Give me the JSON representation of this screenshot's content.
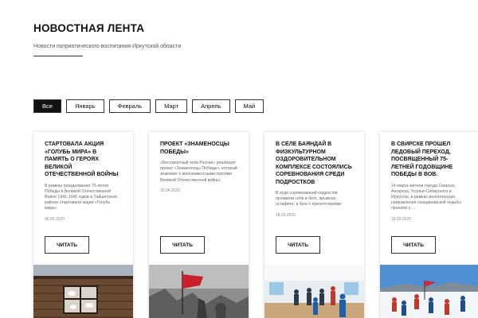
{
  "header": {
    "title": "НОВОСТНАЯ ЛЕНТА",
    "subtitle": "Новости патриотического воспитания Иркутской области"
  },
  "filters": [
    "Все",
    "Январь",
    "Февраль",
    "Март",
    "Апрель",
    "Май"
  ],
  "active_filter": "Все",
  "cards": [
    {
      "title": "СТАРТОВАЛА АКЦИЯ «ГОЛУБЬ МИРА» В ПАМЯТЬ О ГЕРОЯХ ВЕЛИКОЙ ОТЕЧЕСТВЕННОЙ ВОЙНЫ",
      "text": "В рамках празднования 75-летия Победы в Великой Отечественной Войне 1941-1945 годов в Тайшетском районе стартовала акция «Голубь мира»",
      "date": "06.05.2020",
      "button": "ЧИТАТЬ"
    },
    {
      "title": "ПРОЕКТ «ЗНАМЕНОСЦЫ ПОБЕДЫ»",
      "text": "«Бессмертный полк России» реализует проект «Знаменосцы Победы», который знакомит с малоизвестными героями Великой Отечественной войны.",
      "date": "20.04.2020",
      "button": "ЧИТАТЬ"
    },
    {
      "title": "В СЕЛЕ БАЯНДАЙ В ФИЗКУЛЬТУРНОМ ОЗДОРОВИТЕЛЬНОМ КОМПЛЕКСЕ СОСТОЯЛИСЬ СОРЕВНОВАНИЯ СРЕДИ ПОДРОСТКОВ",
      "text": "В ходе соревнований подростки проявили себя в беге, прыжках, эстафете, в беге с препятствиями",
      "date": "18.03.2020",
      "button": "ЧИТАТЬ"
    },
    {
      "title": "В СВИРСКЕ ПРОШЕЛ ЛЕДОВЫЙ ПЕРЕХОД, ПОСВЯЩЕННЫЙ 75-ЛЕТНЕЙ ГОДОВЩИНЕ ПОБЕДЫ В ВОВ.",
      "text": "14 марта жители города Свирска, Ангарска, Усолье-Сибирского и Иркутска, в рамках волонтерских направления скандинавской ходьбы приняли у ...",
      "date": "18.03.2020",
      "button": "ЧИТАТЬ"
    }
  ],
  "colors": {
    "active_filter_bg": "#111111",
    "border": "#333333"
  }
}
